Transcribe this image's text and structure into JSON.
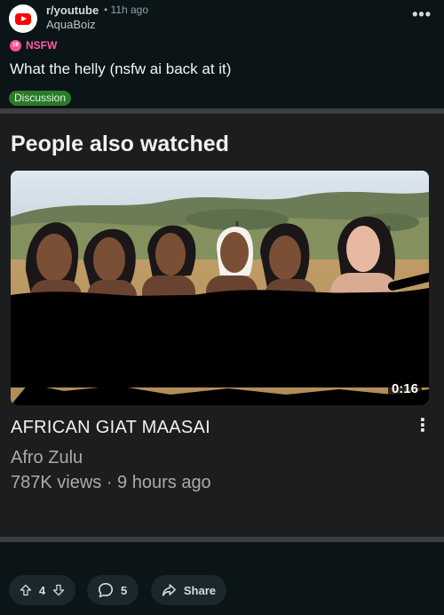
{
  "post": {
    "subreddit": "r/youtube",
    "time": "• 11h ago",
    "user": "AquaBoiz",
    "nsfw_label": "NSFW",
    "title": "What the helly (nsfw ai back at it)",
    "flair": "Discussion",
    "more_icon": "more-horizontal-icon"
  },
  "embed": {
    "heading": "People also watched",
    "video": {
      "duration": "0:16",
      "title": "AFRICAN GIAT MAASAI",
      "channel": "Afro Zulu",
      "meta": "787K views · 9 hours ago"
    }
  },
  "footer": {
    "upvote_icon": "upvote-icon",
    "score": "4",
    "downvote_icon": "downvote-icon",
    "comment_icon": "comment-icon",
    "comments": "5",
    "share_icon": "share-icon",
    "share_label": "Share"
  },
  "colors": {
    "background": "#0b1416",
    "nsfw": "#ff5ca8",
    "flair": "#2a7a2a",
    "pill": "#1a282d"
  }
}
